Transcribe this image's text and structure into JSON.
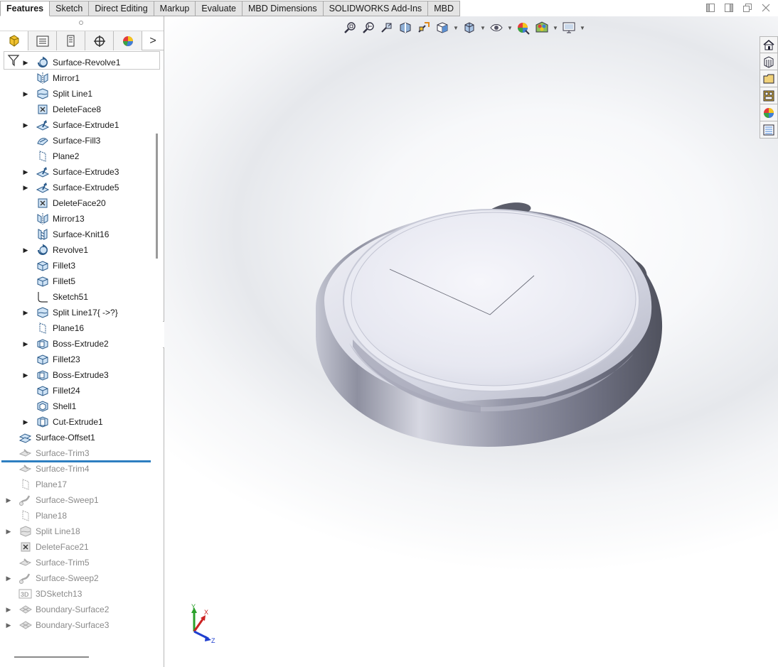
{
  "tabs": [
    {
      "label": "Features",
      "active": true
    },
    {
      "label": "Sketch",
      "active": false
    },
    {
      "label": "Direct Editing",
      "active": false
    },
    {
      "label": "Markup",
      "active": false
    },
    {
      "label": "Evaluate",
      "active": false
    },
    {
      "label": "MBD Dimensions",
      "active": false
    },
    {
      "label": "SOLIDWORKS Add-Ins",
      "active": false
    },
    {
      "label": "MBD",
      "active": false
    }
  ],
  "window_controls": [
    "restore-left-icon",
    "restore-right-icon",
    "maximize-icon",
    "close-icon"
  ],
  "panel_tabs": [
    {
      "icon": "feature-manager-icon",
      "active": true
    },
    {
      "icon": "property-manager-icon",
      "active": false
    },
    {
      "icon": "configuration-manager-icon",
      "active": false
    },
    {
      "icon": "dimxpert-manager-icon",
      "active": false
    },
    {
      "icon": "display-manager-icon",
      "active": false
    }
  ],
  "panel_more": ">",
  "tree": {
    "items": [
      {
        "label": "Surface-Revolve1",
        "icon": "surface-revolve-icon",
        "expandable": true,
        "indent": 1,
        "suppressed": false
      },
      {
        "label": "Mirror1",
        "icon": "mirror-icon",
        "expandable": false,
        "indent": 1,
        "suppressed": false
      },
      {
        "label": "Split Line1",
        "icon": "split-line-icon",
        "expandable": true,
        "indent": 1,
        "suppressed": false
      },
      {
        "label": "DeleteFace8",
        "icon": "delete-face-icon",
        "expandable": false,
        "indent": 1,
        "suppressed": false
      },
      {
        "label": "Surface-Extrude1",
        "icon": "surface-extrude-icon",
        "expandable": true,
        "indent": 1,
        "suppressed": false
      },
      {
        "label": "Surface-Fill3",
        "icon": "surface-fill-icon",
        "expandable": false,
        "indent": 1,
        "suppressed": false
      },
      {
        "label": "Plane2",
        "icon": "plane-icon",
        "expandable": false,
        "indent": 1,
        "suppressed": false
      },
      {
        "label": "Surface-Extrude3",
        "icon": "surface-extrude-icon",
        "expandable": true,
        "indent": 1,
        "suppressed": false
      },
      {
        "label": "Surface-Extrude5",
        "icon": "surface-extrude-icon",
        "expandable": true,
        "indent": 1,
        "suppressed": false
      },
      {
        "label": "DeleteFace20",
        "icon": "delete-face-icon",
        "expandable": false,
        "indent": 1,
        "suppressed": false
      },
      {
        "label": "Mirror13",
        "icon": "mirror-icon",
        "expandable": false,
        "indent": 1,
        "suppressed": false
      },
      {
        "label": "Surface-Knit16",
        "icon": "surface-knit-icon",
        "expandable": false,
        "indent": 1,
        "suppressed": false
      },
      {
        "label": "Revolve1",
        "icon": "revolve-icon",
        "expandable": true,
        "indent": 1,
        "suppressed": false
      },
      {
        "label": "Fillet3",
        "icon": "fillet-icon",
        "expandable": false,
        "indent": 1,
        "suppressed": false
      },
      {
        "label": "Fillet5",
        "icon": "fillet-icon",
        "expandable": false,
        "indent": 1,
        "suppressed": false
      },
      {
        "label": "Sketch51",
        "icon": "sketch-icon",
        "expandable": false,
        "indent": 1,
        "suppressed": false
      },
      {
        "label": "Split Line17{ ->?}",
        "icon": "split-line-icon",
        "expandable": true,
        "indent": 1,
        "suppressed": false
      },
      {
        "label": "Plane16",
        "icon": "plane-icon",
        "expandable": false,
        "indent": 1,
        "suppressed": false
      },
      {
        "label": "Boss-Extrude2",
        "icon": "boss-extrude-icon",
        "expandable": true,
        "indent": 1,
        "suppressed": false
      },
      {
        "label": "Fillet23",
        "icon": "fillet-icon",
        "expandable": false,
        "indent": 1,
        "suppressed": false
      },
      {
        "label": "Boss-Extrude3",
        "icon": "boss-extrude-icon",
        "expandable": true,
        "indent": 1,
        "suppressed": false
      },
      {
        "label": "Fillet24",
        "icon": "fillet-icon",
        "expandable": false,
        "indent": 1,
        "suppressed": false
      },
      {
        "label": "Shell1",
        "icon": "shell-icon",
        "expandable": false,
        "indent": 1,
        "suppressed": false
      },
      {
        "label": "Cut-Extrude1",
        "icon": "cut-extrude-icon",
        "expandable": true,
        "indent": 1,
        "suppressed": false
      },
      {
        "label": "Surface-Offset1",
        "icon": "surface-offset-icon",
        "expandable": false,
        "indent": 0,
        "suppressed": false
      },
      {
        "label": "Surface-Trim3",
        "icon": "surface-trim-icon",
        "expandable": false,
        "indent": 0,
        "suppressed": true
      },
      {
        "label": "Surface-Trim4",
        "icon": "surface-trim-icon",
        "expandable": false,
        "indent": 0,
        "suppressed": true
      },
      {
        "label": "Plane17",
        "icon": "plane-icon",
        "expandable": false,
        "indent": 0,
        "suppressed": true
      },
      {
        "label": "Surface-Sweep1",
        "icon": "surface-sweep-icon",
        "expandable": true,
        "indent": 0,
        "suppressed": true
      },
      {
        "label": "Plane18",
        "icon": "plane-icon",
        "expandable": false,
        "indent": 0,
        "suppressed": true
      },
      {
        "label": "Split Line18",
        "icon": "split-line-icon",
        "expandable": true,
        "indent": 0,
        "suppressed": true
      },
      {
        "label": "DeleteFace21",
        "icon": "delete-face-icon",
        "expandable": false,
        "indent": 0,
        "suppressed": true
      },
      {
        "label": "Surface-Trim5",
        "icon": "surface-trim-icon",
        "expandable": false,
        "indent": 0,
        "suppressed": true
      },
      {
        "label": "Surface-Sweep2",
        "icon": "surface-sweep-icon",
        "expandable": true,
        "indent": 0,
        "suppressed": true
      },
      {
        "label": "3DSketch13",
        "icon": "3d-sketch-icon",
        "expandable": false,
        "indent": 0,
        "suppressed": true
      },
      {
        "label": "Boundary-Surface2",
        "icon": "boundary-surface-icon",
        "expandable": true,
        "indent": 0,
        "suppressed": true
      },
      {
        "label": "Boundary-Surface3",
        "icon": "boundary-surface-icon",
        "expandable": true,
        "indent": 0,
        "suppressed": true
      }
    ]
  },
  "heads_up_toolbar": [
    {
      "icon": "zoom-to-fit-icon",
      "dropdown": false
    },
    {
      "icon": "zoom-to-area-icon",
      "dropdown": false
    },
    {
      "icon": "previous-view-icon",
      "dropdown": false
    },
    {
      "icon": "section-view-icon",
      "dropdown": false
    },
    {
      "icon": "dynamic-annotation-icon",
      "dropdown": false
    },
    {
      "icon": "view-orientation-icon",
      "dropdown": true
    },
    {
      "icon": "display-style-icon",
      "dropdown": true
    },
    {
      "icon": "hide-show-items-icon",
      "dropdown": true
    },
    {
      "icon": "edit-appearance-icon",
      "dropdown": false
    },
    {
      "icon": "apply-scene-icon",
      "dropdown": true
    },
    {
      "icon": "view-settings-icon",
      "dropdown": true
    }
  ],
  "task_pane": [
    "home-icon",
    "design-library-icon",
    "file-explorer-icon",
    "view-palette-icon",
    "appearances-icon",
    "custom-properties-icon"
  ],
  "triad": {
    "x": "X",
    "y": "Y",
    "z": "Z"
  },
  "colors": {
    "accent": "#2e7fc1",
    "suppressed_text": "#8a8a8a",
    "model_body": "#b8bac6"
  }
}
